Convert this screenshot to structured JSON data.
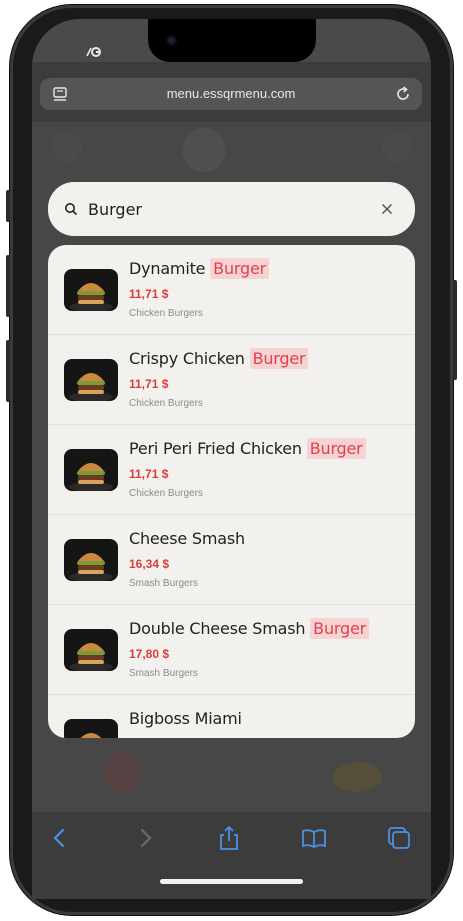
{
  "browser": {
    "url": "menu.essqrmenu.com"
  },
  "search": {
    "value": "Burger",
    "placeholder": ""
  },
  "results": [
    {
      "name": "Dynamite ",
      "highlight": "Burger",
      "price": "11,71 $",
      "category": "Chicken Burgers"
    },
    {
      "name": "Crispy Chicken ",
      "highlight": "Burger",
      "price": "11,71 $",
      "category": "Chicken Burgers"
    },
    {
      "name": "Peri Peri Fried Chicken ",
      "highlight": "Burger",
      "price": "11,71 $",
      "category": "Chicken Burgers"
    },
    {
      "name": "Cheese Smash",
      "highlight": "",
      "price": "16,34 $",
      "category": "Smash Burgers"
    },
    {
      "name": "Double Cheese Smash ",
      "highlight": "Burger",
      "price": "17,80 $",
      "category": "Smash Burgers"
    },
    {
      "name": "Bigboss Miami",
      "highlight": "",
      "price": "",
      "category": ""
    }
  ],
  "toolbar_icons": [
    "back-icon",
    "forward-icon",
    "share-icon",
    "bookmarks-icon",
    "tabs-icon"
  ],
  "colors": {
    "accent_red": "#dd3b3b",
    "highlight_bg": "#f6d3d3",
    "panel_bg": "#f2f1ee"
  }
}
